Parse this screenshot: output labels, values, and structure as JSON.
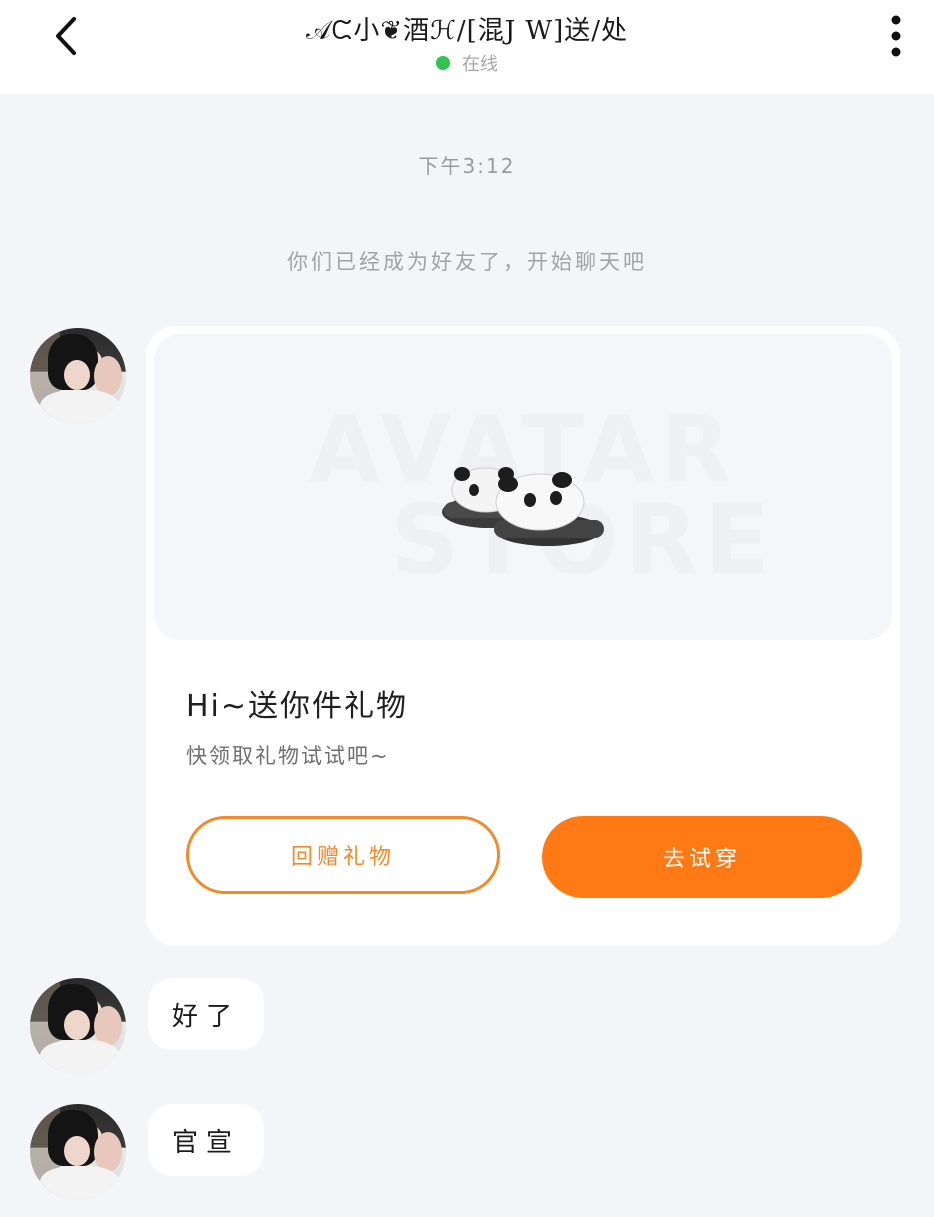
{
  "header": {
    "back_icon": "chevron-left-icon",
    "title": "𝒜ᙅ小❦酒ℋ/[混J W]送/处",
    "status_text": "在线",
    "status_color": "#2fc44f",
    "more_icon": "vertical-ellipsis-icon"
  },
  "chat": {
    "time": "下午3:12",
    "system_notice": "你们已经成为好友了，开始聊天吧",
    "gift_card": {
      "watermark_line1": "AVATAR",
      "watermark_line2": "STORE",
      "image_icon": "panda-slippers-icon",
      "title": "Hi~送你件礼物",
      "subtitle": "快领取礼物试试吧~",
      "return_button": "回赠礼物",
      "try_button": "去试穿",
      "accent_color": "#ff7a15"
    },
    "messages": [
      {
        "text": "好了"
      },
      {
        "text": "官宣"
      }
    ]
  }
}
